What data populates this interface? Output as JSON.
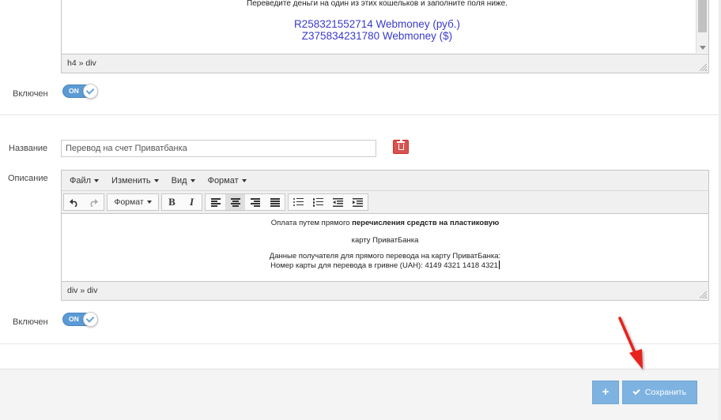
{
  "top_editor": {
    "instruction_text": "Переведите деньги на один из этих кошельков и заполните поля ниже.",
    "wallet_rub": "R258321552714 Webmoney (руб.)",
    "wallet_usd": "Z375834231780 Webmoney ($)",
    "path": "h4 » div"
  },
  "toggle1": {
    "label": "Включен",
    "state": "ON"
  },
  "name_field": {
    "label": "Название",
    "value": "Перевод на счет Приватбанка"
  },
  "description": {
    "label": "Описание",
    "menu": [
      "Файл",
      "Изменить",
      "Вид",
      "Формат"
    ],
    "format_dropdown": "Формат",
    "content": {
      "line1_normal": "Оплата путем прямого ",
      "line1_bold": "перечисления средств на пластиковую",
      "line2": "карту ПриватБанка",
      "line3": "Данные получателя для прямого перевода на карту ПриватБанка:",
      "line4": "Номер карты для перевода в гривне (UAH): 4149 4321 1418 4321"
    },
    "path": "div » div"
  },
  "toggle2": {
    "label": "Включен",
    "state": "ON"
  },
  "footer": {
    "add_label": "+",
    "save_label": "Сохранить"
  },
  "colors": {
    "accent": "#7eb3e1",
    "delete": "#d9534f",
    "annotation": "#e8201e",
    "wallet_link": "#3a3acd"
  }
}
